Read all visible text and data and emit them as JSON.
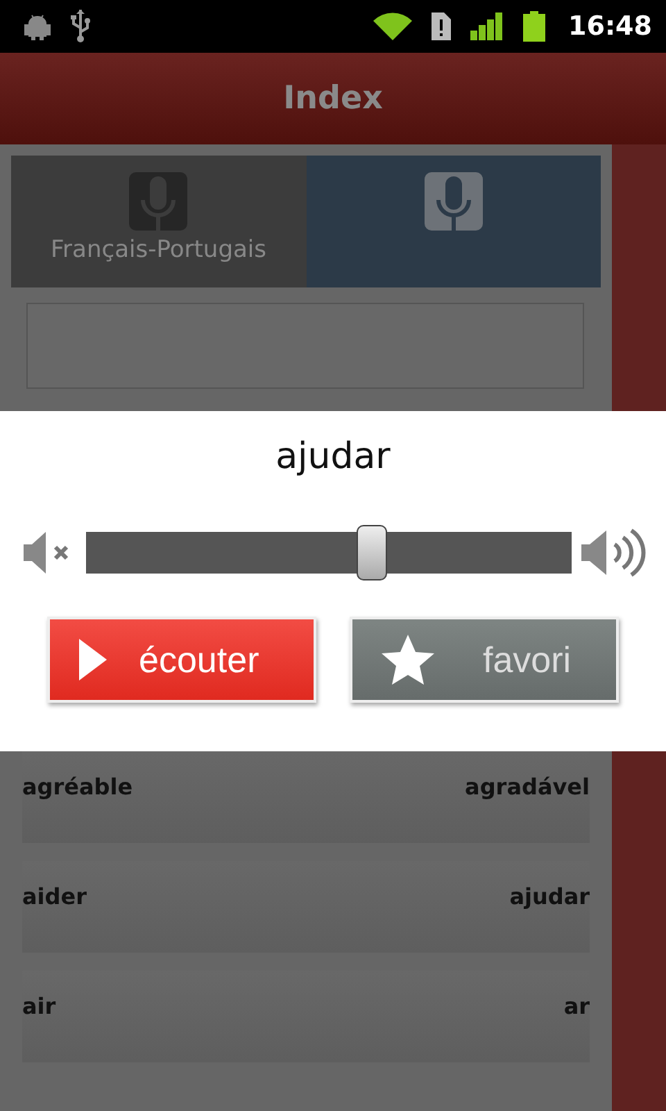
{
  "status_bar": {
    "time": "16:48"
  },
  "title_bar": {
    "title": "Index"
  },
  "tabs": [
    {
      "label": "Français-Portugais",
      "selected": false
    },
    {
      "selected": true
    }
  ],
  "dialog": {
    "word": "ajudar",
    "volume": {
      "level": 0.59
    },
    "buttons": [
      {
        "label": "écouter",
        "kind": "play"
      },
      {
        "label": "favori",
        "kind": "favorite"
      }
    ]
  },
  "list": [
    {
      "french": "agréable",
      "portuguese": "agradável"
    },
    {
      "french": "aider",
      "portuguese": "ajudar"
    },
    {
      "french": "air",
      "portuguese": "ar"
    }
  ]
}
